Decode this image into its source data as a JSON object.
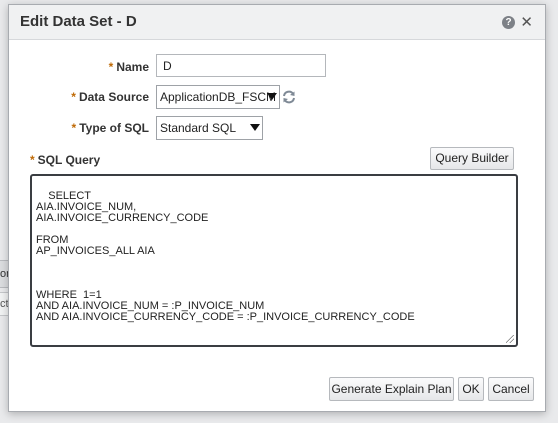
{
  "background": {
    "tab_text": "on",
    "tab2_text": "cti"
  },
  "dialog": {
    "title": "Edit Data Set - D",
    "help_glyph": "?",
    "close_glyph": "✕"
  },
  "form": {
    "required_marker": "*",
    "name": {
      "label": "Name",
      "value": "D"
    },
    "data_source": {
      "label": "Data Source",
      "value": "ApplicationDB_FSCM"
    },
    "type_of_sql": {
      "label": "Type of SQL",
      "value": "Standard SQL"
    },
    "sql_query": {
      "label": "SQL Query",
      "value": "SELECT\nAIA.INVOICE_NUM,\nAIA.INVOICE_CURRENCY_CODE\n\nFROM\nAP_INVOICES_ALL AIA\n\n\n\nWHERE  1=1\nAND AIA.INVOICE_NUM = :P_INVOICE_NUM\nAND AIA.INVOICE_CURRENCY_CODE = :P_INVOICE_CURRENCY_CODE"
    }
  },
  "buttons": {
    "query_builder": "Query Builder",
    "generate_explain_plan": "Generate Explain Plan",
    "ok": "OK",
    "cancel": "Cancel"
  },
  "icons": {
    "help": "help-icon",
    "close": "close-icon",
    "refresh": "refresh-icon",
    "dropdown": "chevron-down-icon"
  },
  "colors": {
    "required": "#bf6a06",
    "title_bar": "#f0f1f2",
    "sql_border": "#3a3d42"
  }
}
